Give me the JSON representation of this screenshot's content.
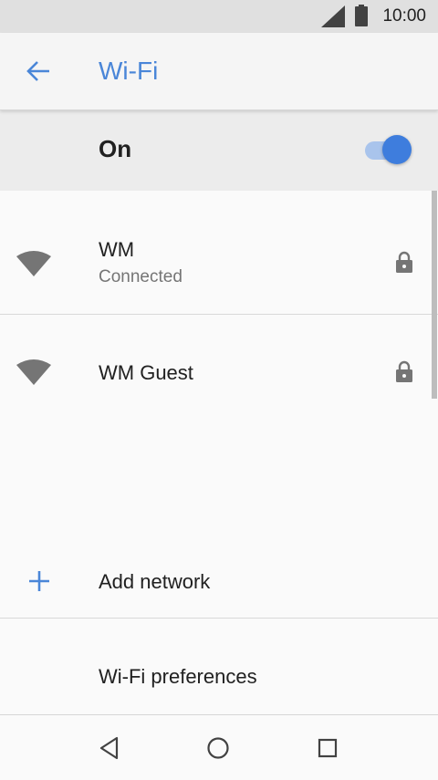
{
  "status_bar": {
    "time": "10:00",
    "icons": [
      "signal-icon",
      "battery-icon"
    ]
  },
  "app_bar": {
    "title": "Wi-Fi",
    "back_icon": "arrow-back-icon"
  },
  "master_switch": {
    "label": "On",
    "state": true,
    "track_color": "#a9c4ec",
    "thumb_color": "#3e7ddd"
  },
  "networks": [
    {
      "name": "WM",
      "status": "Connected",
      "secured": true,
      "icon": "wifi-full-icon"
    },
    {
      "name": "WM Guest",
      "status": "",
      "secured": true,
      "icon": "wifi-full-icon"
    }
  ],
  "actions": {
    "add_network": "Add network",
    "preferences": "Wi-Fi preferences"
  },
  "nav_bar": {
    "buttons": [
      "nav-back-icon",
      "nav-home-icon",
      "nav-recents-icon"
    ]
  },
  "colors": {
    "accent": "#4a86d8",
    "status_bar_bg": "#e0e0e0",
    "icon_gray": "#757575"
  }
}
